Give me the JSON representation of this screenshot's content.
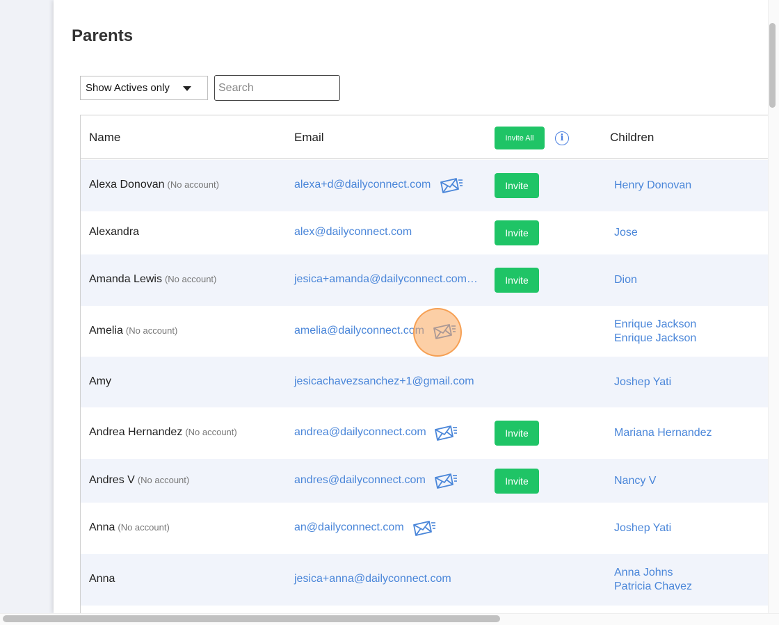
{
  "page": {
    "title": "Parents"
  },
  "filters": {
    "status_select_value": "Show Actives only",
    "search_placeholder": "Search",
    "search_value": ""
  },
  "table": {
    "headers": {
      "name": "Name",
      "email": "Email",
      "invite_all": "Invite All",
      "info": "i",
      "children": "Children"
    },
    "invite_label": "Invite",
    "rows": [
      {
        "name": "Alexa Donovan",
        "status": "(No account)",
        "email": "alexa+d@dailyconnect.com",
        "mail_icon": true,
        "invite": true,
        "children": [
          "Henry Donovan"
        ]
      },
      {
        "name": "Alexandra",
        "status": "",
        "email": "alex@dailyconnect.com",
        "mail_icon": false,
        "invite": true,
        "children": [
          "Jose"
        ]
      },
      {
        "name": "Amanda Lewis",
        "status": "(No account)",
        "email": "jesica+amanda@dailyconnect.com…",
        "mail_icon": false,
        "invite": true,
        "children": [
          "Dion"
        ]
      },
      {
        "name": "Amelia",
        "status": "(No account)",
        "email": "amelia@dailyconnect.com",
        "mail_icon": true,
        "invite": false,
        "children": [
          "Enrique Jackson",
          "Enrique Jackson"
        ]
      },
      {
        "name": "Amy",
        "status": "",
        "email": "jesicachavezsanchez+1@gmail.com",
        "mail_icon": false,
        "invite": false,
        "children": [
          "Joshep Yati"
        ]
      },
      {
        "name": "Andrea Hernandez",
        "status": "(No account)",
        "email": "andrea@dailyconnect.com",
        "mail_icon": true,
        "invite": true,
        "children": [
          "Mariana Hernandez"
        ]
      },
      {
        "name": "Andres V",
        "status": "(No account)",
        "email": "andres@dailyconnect.com",
        "mail_icon": true,
        "invite": true,
        "children": [
          "Nancy V"
        ]
      },
      {
        "name": "Anna",
        "status": "(No account)",
        "email": "an@dailyconnect.com",
        "mail_icon": true,
        "invite": false,
        "children": [
          "Joshep Yati"
        ]
      },
      {
        "name": "Anna",
        "status": "",
        "email": "jesica+anna@dailyconnect.com",
        "mail_icon": false,
        "invite": false,
        "children": [
          "Anna Johns",
          "Patricia Chavez"
        ]
      }
    ]
  },
  "colors": {
    "accent_green": "#1fc466",
    "link_blue": "#4a86d9",
    "row_alt": "#f1f4fb",
    "click_highlight": "#faa85c"
  }
}
